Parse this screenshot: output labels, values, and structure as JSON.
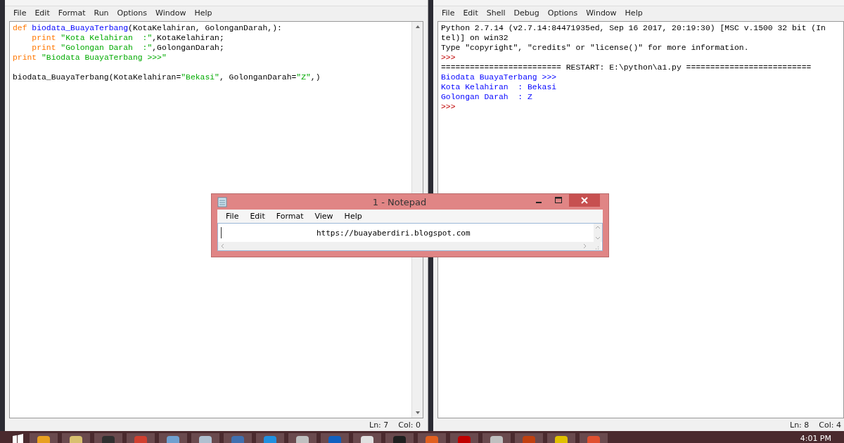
{
  "editor": {
    "menu": [
      "File",
      "Edit",
      "Format",
      "Run",
      "Options",
      "Window",
      "Help"
    ],
    "lines": [
      {
        "kind": "code",
        "indented": false,
        "tokens": [
          {
            "kind": "keyword",
            "text": "def "
          },
          {
            "kind": "defname",
            "text": "biodata_BuayaTerbang"
          },
          {
            "kind": "plain",
            "text": "(KotaKelahiran, GolonganDarah,):"
          }
        ]
      },
      {
        "kind": "code",
        "indented": true,
        "tokens": [
          {
            "kind": "keyword",
            "text": "print "
          },
          {
            "kind": "string",
            "text": "\"Kota Kelahiran  :\""
          },
          {
            "kind": "plain",
            "text": ",KotaKelahiran;"
          }
        ]
      },
      {
        "kind": "code",
        "indented": true,
        "tokens": [
          {
            "kind": "keyword",
            "text": "print "
          },
          {
            "kind": "string",
            "text": "\"Golongan Darah  :\""
          },
          {
            "kind": "plain",
            "text": ",GolonganDarah;"
          }
        ]
      },
      {
        "kind": "code",
        "indented": false,
        "tokens": [
          {
            "kind": "keyword",
            "text": "print "
          },
          {
            "kind": "string",
            "text": "\"Biodata BuayaTerbang >>>\""
          }
        ]
      },
      {
        "kind": "blank"
      },
      {
        "kind": "code",
        "indented": false,
        "tokens": [
          {
            "kind": "plain",
            "text": "biodata_BuayaTerbang(KotaKelahiran="
          },
          {
            "kind": "string",
            "text": "\"Bekasi\""
          },
          {
            "kind": "plain",
            "text": ", GolonganDarah="
          },
          {
            "kind": "string",
            "text": "\"Z\""
          },
          {
            "kind": "plain",
            "text": ",)"
          }
        ]
      }
    ],
    "status": [
      "Ln: 7",
      "Col: 0"
    ]
  },
  "shell": {
    "menu": [
      "File",
      "Edit",
      "Shell",
      "Debug",
      "Options",
      "Window",
      "Help"
    ],
    "lines": [
      {
        "kind": "plain",
        "text": "Python 2.7.14 (v2.7.14:84471935ed, Sep 16 2017, 20:19:30) [MSC v.1500 32 bit (In"
      },
      {
        "kind": "plain",
        "text": "tel)] on win32"
      },
      {
        "kind": "plain",
        "text": "Type \"copyright\", \"credits\" or \"license()\" for more information."
      },
      {
        "kind": "prompt",
        "text": ">>>"
      },
      {
        "kind": "plain",
        "text": "========================= RESTART: E:\\python\\a1.py =========================="
      },
      {
        "kind": "stdout",
        "text": "Biodata BuayaTerbang >>>"
      },
      {
        "kind": "stdout",
        "text": "Kota Kelahiran  : Bekasi"
      },
      {
        "kind": "stdout",
        "text": "Golongan Darah  : Z"
      },
      {
        "kind": "prompt",
        "text": ">>>"
      }
    ],
    "status": [
      "Ln: 8",
      "Col: 4"
    ]
  },
  "notepad": {
    "title": "1 - Notepad",
    "menu": [
      "File",
      "Edit",
      "Format",
      "View",
      "Help"
    ],
    "text": "https://buayaberdiri.blogspot.com"
  },
  "taskbar": {
    "clock": "4:01 PM"
  }
}
